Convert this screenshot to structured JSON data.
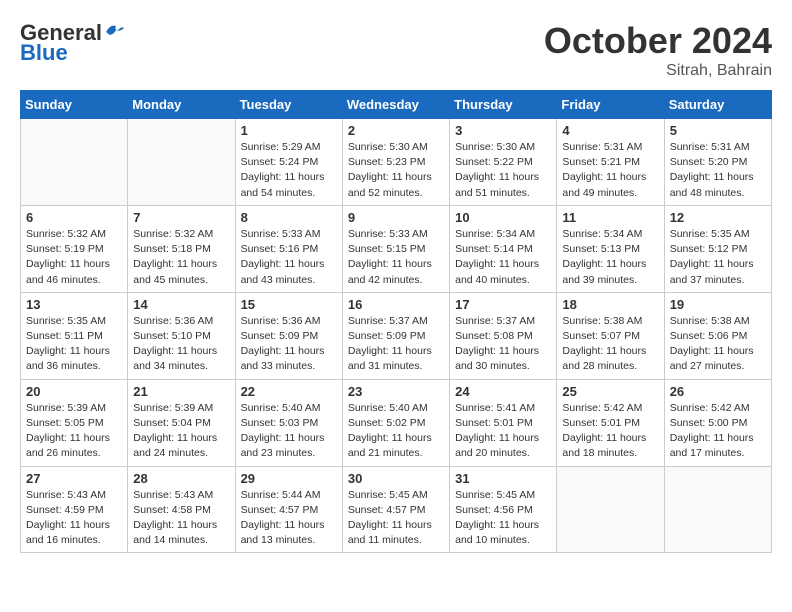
{
  "header": {
    "logo_general": "General",
    "logo_blue": "Blue",
    "month_title": "October 2024",
    "location": "Sitrah, Bahrain"
  },
  "days_of_week": [
    "Sunday",
    "Monday",
    "Tuesday",
    "Wednesday",
    "Thursday",
    "Friday",
    "Saturday"
  ],
  "weeks": [
    [
      {
        "day": "",
        "sunrise": "",
        "sunset": "",
        "daylight": ""
      },
      {
        "day": "",
        "sunrise": "",
        "sunset": "",
        "daylight": ""
      },
      {
        "day": "1",
        "sunrise": "Sunrise: 5:29 AM",
        "sunset": "Sunset: 5:24 PM",
        "daylight": "Daylight: 11 hours and 54 minutes."
      },
      {
        "day": "2",
        "sunrise": "Sunrise: 5:30 AM",
        "sunset": "Sunset: 5:23 PM",
        "daylight": "Daylight: 11 hours and 52 minutes."
      },
      {
        "day": "3",
        "sunrise": "Sunrise: 5:30 AM",
        "sunset": "Sunset: 5:22 PM",
        "daylight": "Daylight: 11 hours and 51 minutes."
      },
      {
        "day": "4",
        "sunrise": "Sunrise: 5:31 AM",
        "sunset": "Sunset: 5:21 PM",
        "daylight": "Daylight: 11 hours and 49 minutes."
      },
      {
        "day": "5",
        "sunrise": "Sunrise: 5:31 AM",
        "sunset": "Sunset: 5:20 PM",
        "daylight": "Daylight: 11 hours and 48 minutes."
      }
    ],
    [
      {
        "day": "6",
        "sunrise": "Sunrise: 5:32 AM",
        "sunset": "Sunset: 5:19 PM",
        "daylight": "Daylight: 11 hours and 46 minutes."
      },
      {
        "day": "7",
        "sunrise": "Sunrise: 5:32 AM",
        "sunset": "Sunset: 5:18 PM",
        "daylight": "Daylight: 11 hours and 45 minutes."
      },
      {
        "day": "8",
        "sunrise": "Sunrise: 5:33 AM",
        "sunset": "Sunset: 5:16 PM",
        "daylight": "Daylight: 11 hours and 43 minutes."
      },
      {
        "day": "9",
        "sunrise": "Sunrise: 5:33 AM",
        "sunset": "Sunset: 5:15 PM",
        "daylight": "Daylight: 11 hours and 42 minutes."
      },
      {
        "day": "10",
        "sunrise": "Sunrise: 5:34 AM",
        "sunset": "Sunset: 5:14 PM",
        "daylight": "Daylight: 11 hours and 40 minutes."
      },
      {
        "day": "11",
        "sunrise": "Sunrise: 5:34 AM",
        "sunset": "Sunset: 5:13 PM",
        "daylight": "Daylight: 11 hours and 39 minutes."
      },
      {
        "day": "12",
        "sunrise": "Sunrise: 5:35 AM",
        "sunset": "Sunset: 5:12 PM",
        "daylight": "Daylight: 11 hours and 37 minutes."
      }
    ],
    [
      {
        "day": "13",
        "sunrise": "Sunrise: 5:35 AM",
        "sunset": "Sunset: 5:11 PM",
        "daylight": "Daylight: 11 hours and 36 minutes."
      },
      {
        "day": "14",
        "sunrise": "Sunrise: 5:36 AM",
        "sunset": "Sunset: 5:10 PM",
        "daylight": "Daylight: 11 hours and 34 minutes."
      },
      {
        "day": "15",
        "sunrise": "Sunrise: 5:36 AM",
        "sunset": "Sunset: 5:09 PM",
        "daylight": "Daylight: 11 hours and 33 minutes."
      },
      {
        "day": "16",
        "sunrise": "Sunrise: 5:37 AM",
        "sunset": "Sunset: 5:09 PM",
        "daylight": "Daylight: 11 hours and 31 minutes."
      },
      {
        "day": "17",
        "sunrise": "Sunrise: 5:37 AM",
        "sunset": "Sunset: 5:08 PM",
        "daylight": "Daylight: 11 hours and 30 minutes."
      },
      {
        "day": "18",
        "sunrise": "Sunrise: 5:38 AM",
        "sunset": "Sunset: 5:07 PM",
        "daylight": "Daylight: 11 hours and 28 minutes."
      },
      {
        "day": "19",
        "sunrise": "Sunrise: 5:38 AM",
        "sunset": "Sunset: 5:06 PM",
        "daylight": "Daylight: 11 hours and 27 minutes."
      }
    ],
    [
      {
        "day": "20",
        "sunrise": "Sunrise: 5:39 AM",
        "sunset": "Sunset: 5:05 PM",
        "daylight": "Daylight: 11 hours and 26 minutes."
      },
      {
        "day": "21",
        "sunrise": "Sunrise: 5:39 AM",
        "sunset": "Sunset: 5:04 PM",
        "daylight": "Daylight: 11 hours and 24 minutes."
      },
      {
        "day": "22",
        "sunrise": "Sunrise: 5:40 AM",
        "sunset": "Sunset: 5:03 PM",
        "daylight": "Daylight: 11 hours and 23 minutes."
      },
      {
        "day": "23",
        "sunrise": "Sunrise: 5:40 AM",
        "sunset": "Sunset: 5:02 PM",
        "daylight": "Daylight: 11 hours and 21 minutes."
      },
      {
        "day": "24",
        "sunrise": "Sunrise: 5:41 AM",
        "sunset": "Sunset: 5:01 PM",
        "daylight": "Daylight: 11 hours and 20 minutes."
      },
      {
        "day": "25",
        "sunrise": "Sunrise: 5:42 AM",
        "sunset": "Sunset: 5:01 PM",
        "daylight": "Daylight: 11 hours and 18 minutes."
      },
      {
        "day": "26",
        "sunrise": "Sunrise: 5:42 AM",
        "sunset": "Sunset: 5:00 PM",
        "daylight": "Daylight: 11 hours and 17 minutes."
      }
    ],
    [
      {
        "day": "27",
        "sunrise": "Sunrise: 5:43 AM",
        "sunset": "Sunset: 4:59 PM",
        "daylight": "Daylight: 11 hours and 16 minutes."
      },
      {
        "day": "28",
        "sunrise": "Sunrise: 5:43 AM",
        "sunset": "Sunset: 4:58 PM",
        "daylight": "Daylight: 11 hours and 14 minutes."
      },
      {
        "day": "29",
        "sunrise": "Sunrise: 5:44 AM",
        "sunset": "Sunset: 4:57 PM",
        "daylight": "Daylight: 11 hours and 13 minutes."
      },
      {
        "day": "30",
        "sunrise": "Sunrise: 5:45 AM",
        "sunset": "Sunset: 4:57 PM",
        "daylight": "Daylight: 11 hours and 11 minutes."
      },
      {
        "day": "31",
        "sunrise": "Sunrise: 5:45 AM",
        "sunset": "Sunset: 4:56 PM",
        "daylight": "Daylight: 11 hours and 10 minutes."
      },
      {
        "day": "",
        "sunrise": "",
        "sunset": "",
        "daylight": ""
      },
      {
        "day": "",
        "sunrise": "",
        "sunset": "",
        "daylight": ""
      }
    ]
  ]
}
